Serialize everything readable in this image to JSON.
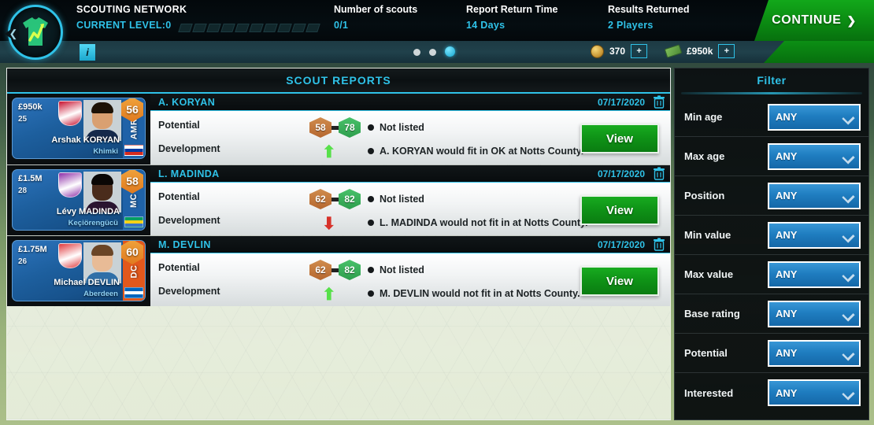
{
  "header": {
    "crest_icon": "shirt-growth-icon",
    "back_icon": "back-chevron-icon",
    "scouting_title": "SCOUTING NETWORK",
    "current_level": "CURRENT LEVEL:0",
    "level_segments": 10,
    "level_filled": 0,
    "stats": [
      {
        "label": "Number of scouts",
        "value": "0/1"
      },
      {
        "label": "Report Return Time",
        "value": "14 Days"
      },
      {
        "label": "Results Returned",
        "value": "2 Players"
      }
    ],
    "continue_label": "CONTINUE",
    "continue_chevron": "❯"
  },
  "subbar": {
    "info_icon": "info-icon",
    "info_label": "i",
    "dots": [
      {
        "active": false
      },
      {
        "active": false
      },
      {
        "active": true
      }
    ],
    "coin_icon": "coin-icon",
    "coin_value": "370",
    "coin_add_label": "+",
    "cash_icon": "banknote-icon",
    "cash_value": "£950k",
    "cash_add_label": "+"
  },
  "reports": {
    "title": "SCOUT REPORTS",
    "labels": {
      "potential": "Potential",
      "development": "Development"
    },
    "view_label": "View",
    "delete_icon": "trash-icon",
    "rows": [
      {
        "report_name": "A. KORYAN",
        "date": "07/17/2020",
        "card": {
          "value": "£950k",
          "age": "25",
          "full_name": "Arshak KORYAN",
          "club": "Khimki",
          "position": "AMR",
          "rating": "56",
          "position_color": "#1f62a8",
          "rating_color": "#e07a1f",
          "crest_color": "#c8102e",
          "skin_color": "#d9a071",
          "hair_color": "#1d1207",
          "kit_color": "#15294a",
          "flag_colors": [
            "#ffffff",
            "#0039a6",
            "#d52b1e"
          ]
        },
        "potential_current": "58",
        "potential_target": "78",
        "potential_current_color": "#b5672f",
        "potential_target_color": "#2e9e4d",
        "development_direction": "up",
        "development_color": "#57e04a",
        "status_note": "Not listed",
        "fit_note": "A. KORYAN would fit in OK at Notts County."
      },
      {
        "report_name": "L. MADINDA",
        "date": "07/17/2020",
        "card": {
          "value": "£1.5M",
          "age": "28",
          "full_name": "Lévy MADINDA",
          "club": "Keçiörengücü",
          "position": "MC",
          "rating": "58",
          "position_color": "#1f62a8",
          "rating_color": "#e07a1f",
          "crest_color": "#8e2fa8",
          "skin_color": "#4a2c1c",
          "hair_color": "#0a0705",
          "kit_color": "#2a1430",
          "flag_colors": [
            "#009e60",
            "#fcd116",
            "#3a75c4"
          ]
        },
        "potential_current": "62",
        "potential_target": "82",
        "potential_current_color": "#b5672f",
        "potential_target_color": "#2e9e4d",
        "development_direction": "down",
        "development_color": "#d7322a",
        "status_note": "Not listed",
        "fit_note": "L. MADINDA would not fit in at Notts County."
      },
      {
        "report_name": "M. DEVLIN",
        "date": "07/17/2020",
        "card": {
          "value": "£1.75M",
          "age": "26",
          "full_name": "Michael DEVLIN",
          "club": "Aberdeen",
          "position": "DC",
          "rating": "60",
          "position_color": "#e2581c",
          "rating_color": "#e07a1f",
          "crest_color": "#e03a3e",
          "skin_color": "#e8bb96",
          "hair_color": "#6a4526",
          "kit_color": "#2f6fa8",
          "flag_colors": [
            "#0065bd",
            "#ffffff",
            "#0065bd"
          ]
        },
        "potential_current": "62",
        "potential_target": "82",
        "potential_current_color": "#b5672f",
        "potential_target_color": "#2e9e4d",
        "development_direction": "up",
        "development_color": "#57e04a",
        "status_note": "Not listed",
        "fit_note": "M. DEVLIN would not fit in at Notts County."
      }
    ]
  },
  "filter": {
    "title": "Filter",
    "chevron_icon": "chevron-down-icon",
    "rows": [
      {
        "label": "Min age",
        "value": "ANY"
      },
      {
        "label": "Max age",
        "value": "ANY"
      },
      {
        "label": "Position",
        "value": "ANY"
      },
      {
        "label": "Min value",
        "value": "ANY"
      },
      {
        "label": "Max value",
        "value": "ANY"
      },
      {
        "label": "Base rating",
        "value": "ANY"
      },
      {
        "label": "Potential",
        "value": "ANY"
      },
      {
        "label": "Interested",
        "value": "ANY"
      }
    ]
  }
}
